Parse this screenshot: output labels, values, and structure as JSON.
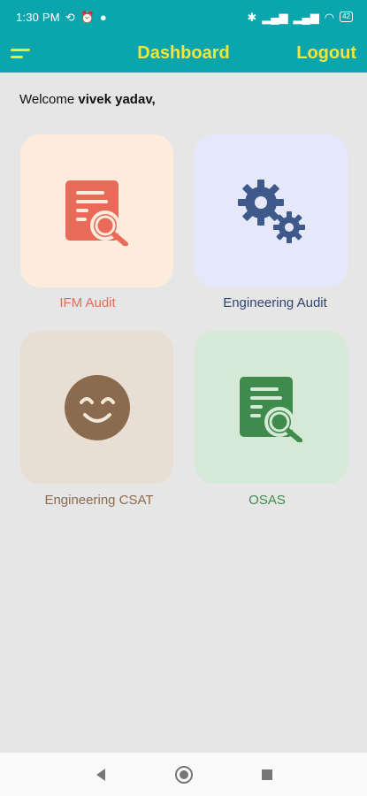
{
  "status_bar": {
    "time": "1:30 PM",
    "battery": "42"
  },
  "app_bar": {
    "title": "Dashboard",
    "logout_label": "Logout"
  },
  "welcome": {
    "prefix": "Welcome",
    "user_name": "vivek yadav,"
  },
  "tiles": [
    {
      "label": "IFM Audit",
      "icon": "document-search-icon"
    },
    {
      "label": "Engineering Audit",
      "icon": "gears-icon"
    },
    {
      "label": "Engineering CSAT",
      "icon": "smiley-face-icon"
    },
    {
      "label": "OSAS",
      "icon": "document-search-icon"
    }
  ],
  "colors": {
    "primary": "#0aa5ad",
    "accent": "#f3e63a"
  }
}
